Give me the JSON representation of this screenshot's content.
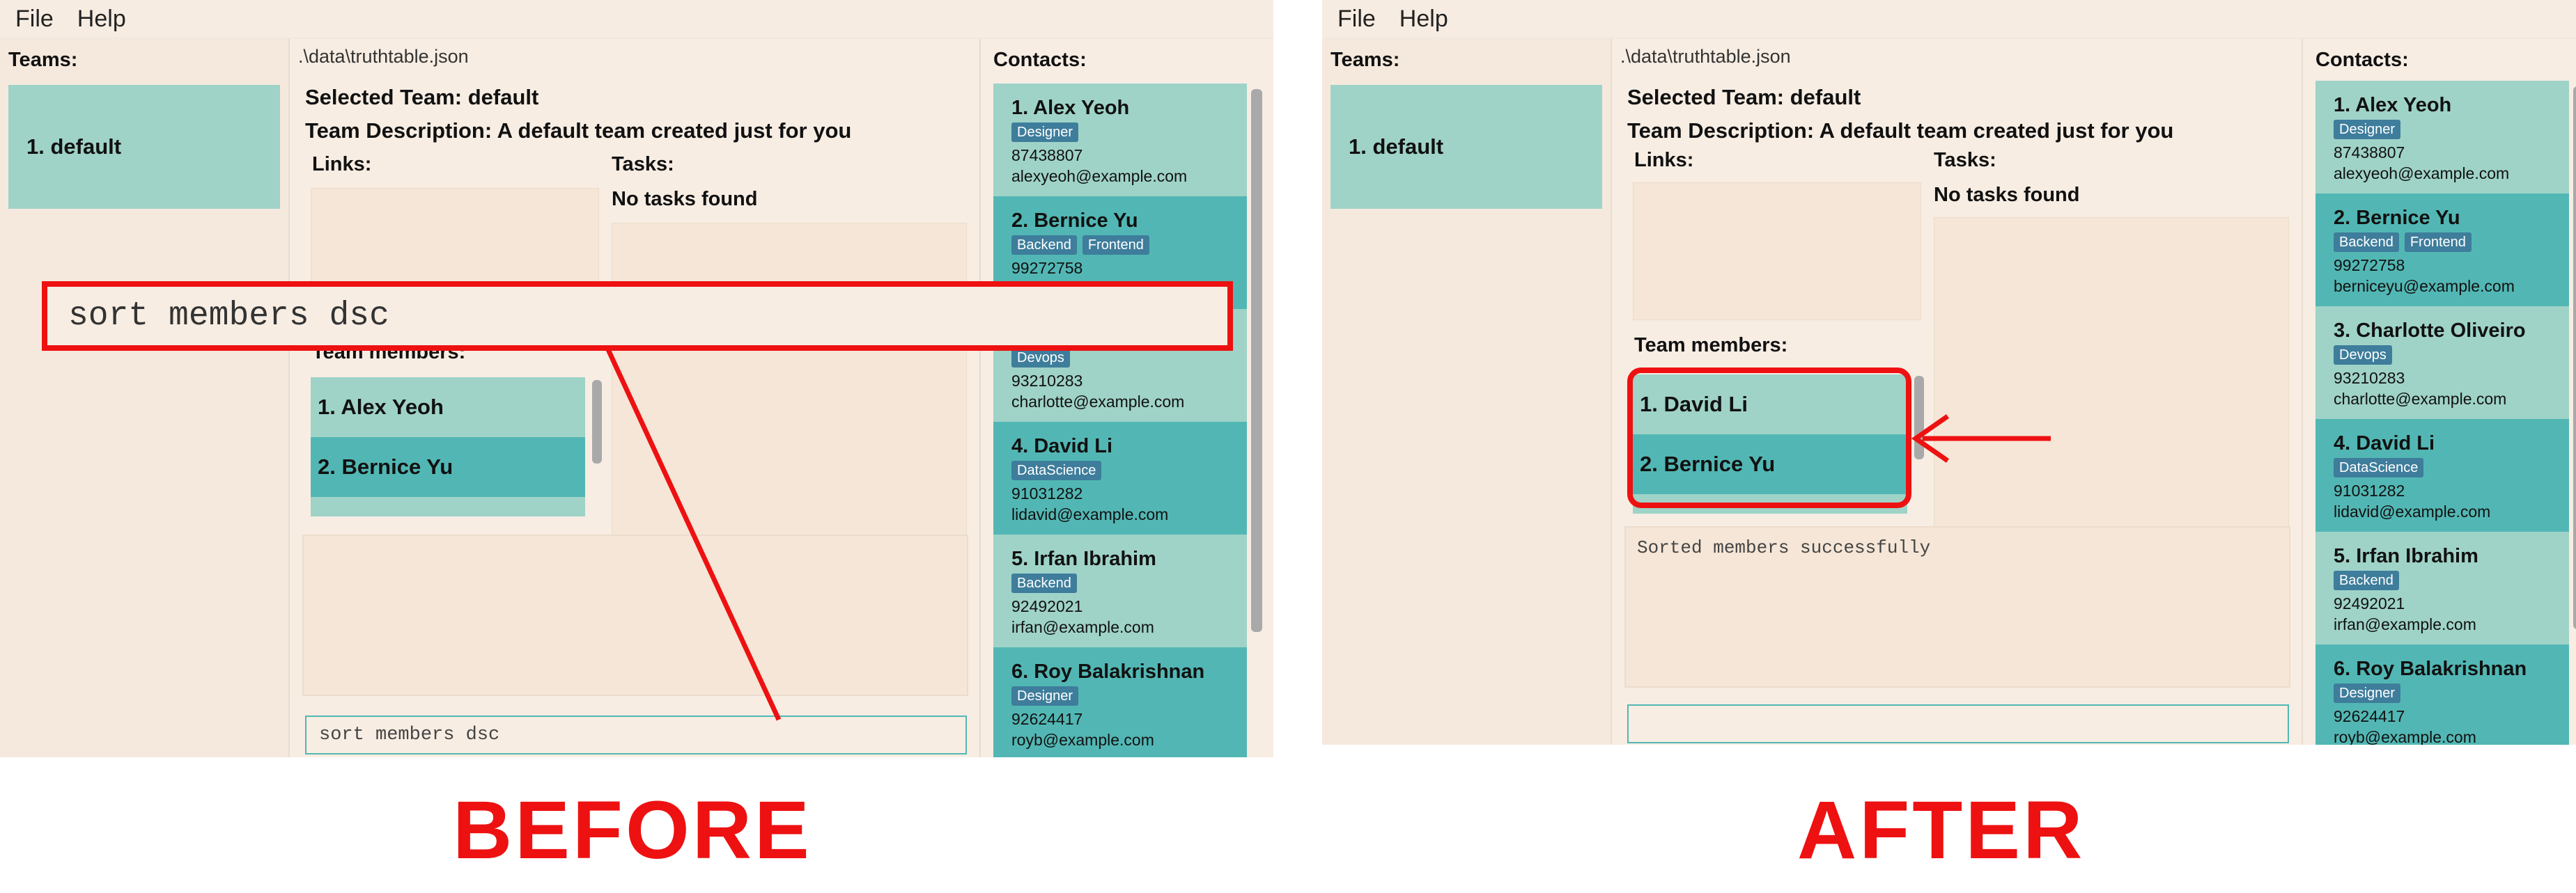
{
  "menu": {
    "file": "File",
    "help": "Help"
  },
  "before": {
    "path": ".\\data\\truthtable.json",
    "teams_title": "Teams:",
    "team": "1. default",
    "selected_team": "Selected Team: default",
    "team_description": "Team Description: A default team created just for you",
    "links_label": "Links:",
    "tasks_label": "Tasks:",
    "no_tasks": "No tasks found",
    "team_members_label": "Team members:",
    "members": [
      "1. Alex Yeoh",
      "2. Bernice Yu"
    ],
    "result_text": "",
    "command_text": "sort members dsc"
  },
  "after": {
    "path": ".\\data\\truthtable.json",
    "teams_title": "Teams:",
    "team": "1. default",
    "selected_team": "Selected Team: default",
    "team_description": "Team Description: A default team created just for you",
    "links_label": "Links:",
    "tasks_label": "Tasks:",
    "no_tasks": "No tasks found",
    "team_members_label": "Team members:",
    "members": [
      "1. David Li",
      "2. Bernice Yu"
    ],
    "result_text": "Sorted members successfully",
    "command_text": ""
  },
  "contacts_title": "Contacts:",
  "contacts": [
    {
      "name": "1. Alex Yeoh",
      "tags": [
        "Designer"
      ],
      "phone": "87438807",
      "email": "alexyeoh@example.com"
    },
    {
      "name": "2. Bernice Yu",
      "tags": [
        "Backend",
        "Frontend"
      ],
      "phone": "99272758",
      "email": "berniceyu@example.com"
    },
    {
      "name": "3. Charlotte Oliveiro",
      "tags": [
        "Devops"
      ],
      "phone": "93210283",
      "email": "charlotte@example.com"
    },
    {
      "name": "4. David Li",
      "tags": [
        "DataScience"
      ],
      "phone": "91031282",
      "email": "lidavid@example.com"
    },
    {
      "name": "5. Irfan Ibrahim",
      "tags": [
        "Backend"
      ],
      "phone": "92492021",
      "email": "irfan@example.com"
    },
    {
      "name": "6. Roy Balakrishnan",
      "tags": [
        "Designer"
      ],
      "phone": "92624417",
      "email": "royb@example.com"
    }
  ],
  "annotations": {
    "command_callout": "sort members dsc",
    "before_caption": "BEFORE",
    "after_caption": "AFTER",
    "color": "#ee1111"
  }
}
